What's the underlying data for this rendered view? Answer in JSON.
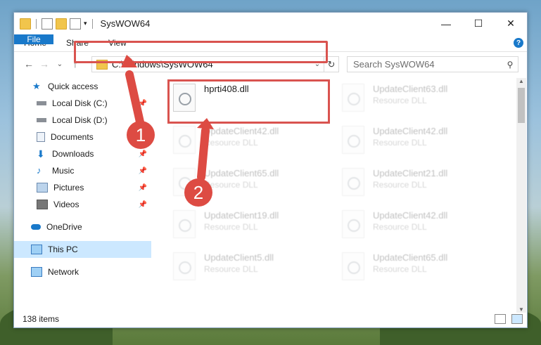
{
  "window": {
    "title": "SysWOW64",
    "minimize": "—",
    "maximize": "☐",
    "close": "✕"
  },
  "ribbon": {
    "file": "File",
    "home": "Home",
    "share": "Share",
    "view": "View",
    "help": "?"
  },
  "nav": {
    "back": "←",
    "forward": "→",
    "recent": "⌄",
    "up": "↑"
  },
  "address": {
    "path": "C:\\Windows\\SysWOW64",
    "dropdown": "⌄",
    "refresh": "↻"
  },
  "search": {
    "placeholder": "Search SysWOW64",
    "icon": "⚲"
  },
  "sidebar": {
    "items": [
      {
        "label": "Quick access"
      },
      {
        "label": "Local Disk (C:)"
      },
      {
        "label": "Local Disk (D:)"
      },
      {
        "label": "Documents"
      },
      {
        "label": "Downloads"
      },
      {
        "label": "Music"
      },
      {
        "label": "Pictures"
      },
      {
        "label": "Videos"
      },
      {
        "label": "OneDrive"
      },
      {
        "label": "This PC"
      },
      {
        "label": "Network"
      }
    ]
  },
  "files": [
    {
      "name": "hprti408.dll",
      "type": ""
    },
    {
      "name": "UpdateClient63.dll",
      "type": "Resource DLL"
    },
    {
      "name": "UpdateClient42.dll",
      "type": "Resource DLL"
    },
    {
      "name": "UpdateClient42.dll",
      "type": "Resource DLL"
    },
    {
      "name": "UpdateClient65.dll",
      "type": "Resource DLL"
    },
    {
      "name": "UpdateClient21.dll",
      "type": "Resource DLL"
    },
    {
      "name": "UpdateClient19.dll",
      "type": "Resource DLL"
    },
    {
      "name": "UpdateClient42.dll",
      "type": "Resource DLL"
    },
    {
      "name": "UpdateClient5.dll",
      "type": "Resource DLL"
    },
    {
      "name": "UpdateClient65.dll",
      "type": "Resource DLL"
    }
  ],
  "status": {
    "count": "138 items"
  },
  "callouts": [
    "1",
    "2"
  ],
  "colors": {
    "accent": "#1979ca",
    "highlight": "#d9534f",
    "selected": "#cce8ff"
  }
}
